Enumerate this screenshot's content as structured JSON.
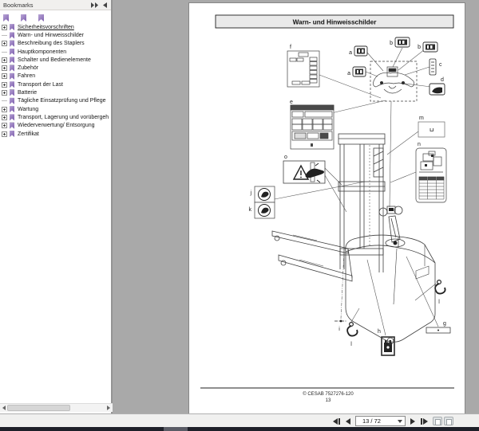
{
  "panel": {
    "title": "Bookmarks",
    "items": [
      {
        "label": "Sicherheitsvorschriften",
        "expandable": true,
        "current": true
      },
      {
        "label": "Warn- und Hinweisschilder",
        "expandable": false,
        "current": false
      },
      {
        "label": "Beschreibung des Staplers",
        "expandable": true,
        "current": false
      },
      {
        "label": "Hauptkomponenten",
        "expandable": false,
        "current": false
      },
      {
        "label": "Schalter und Bedienelemente",
        "expandable": true,
        "current": false
      },
      {
        "label": "Zubehör",
        "expandable": true,
        "current": false
      },
      {
        "label": "Fahren",
        "expandable": true,
        "current": false
      },
      {
        "label": "Transport der Last",
        "expandable": true,
        "current": false
      },
      {
        "label": "Batterie",
        "expandable": true,
        "current": false
      },
      {
        "label": "Tägliche Einsatzprüfung und Pflege",
        "expandable": false,
        "current": false
      },
      {
        "label": "Wartung",
        "expandable": true,
        "current": false
      },
      {
        "label": "Transport, Lagerung und vorübergeh",
        "expandable": true,
        "current": false
      },
      {
        "label": "Wiederverwertung/ Entsorgung",
        "expandable": true,
        "current": false
      },
      {
        "label": "Zertifikat",
        "expandable": true,
        "current": false
      }
    ]
  },
  "doc": {
    "title": "Warn- und Hinweisschilder",
    "footer_copyright": "© CESAB 7527276-120",
    "footer_page": "13",
    "labels": {
      "a1": "a",
      "a2": "a",
      "b1": "b",
      "b2": "b",
      "c": "c",
      "d": "d",
      "e": "e",
      "f": "f",
      "g": "g",
      "h": "h",
      "i": "i",
      "j": "j",
      "k": "k",
      "l1": "l",
      "l2": "l",
      "m": "m",
      "n": "n",
      "o": "o"
    }
  },
  "navbar": {
    "page_indicator": "13 / 72"
  },
  "colors": {
    "ribbon_purple": "#7e5fae",
    "canvas_gray": "#a9a9a9",
    "titlebox_gray": "#e9e9e9",
    "taskbar_dark": "#1e2029"
  }
}
